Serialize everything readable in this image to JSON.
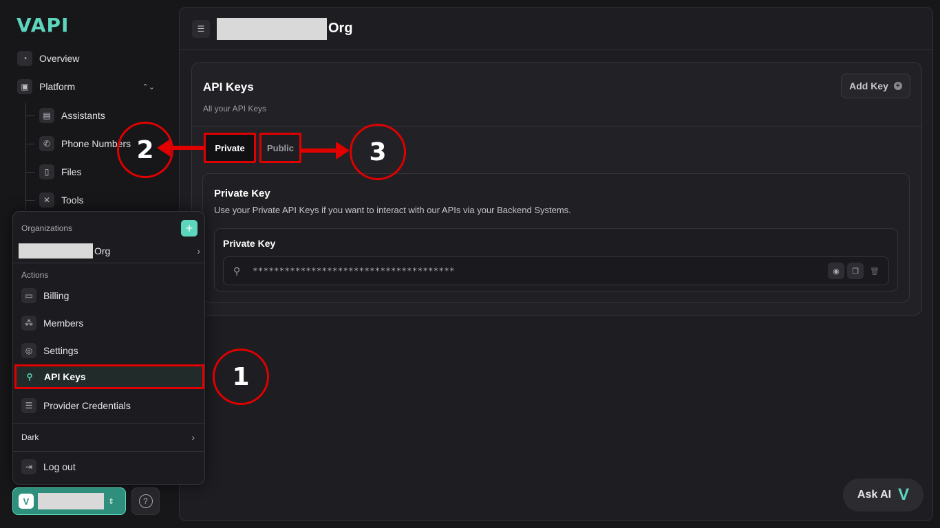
{
  "app": {
    "logo": "VAPI"
  },
  "sidebar": {
    "items": [
      {
        "label": "Overview",
        "icon": "chart-icon"
      },
      {
        "label": "Platform",
        "icon": "chip-icon"
      },
      {
        "label": "Assistants",
        "icon": "user-card-icon"
      },
      {
        "label": "Phone Numbers",
        "icon": "phone-icon"
      },
      {
        "label": "Files",
        "icon": "file-icon"
      },
      {
        "label": "Tools",
        "icon": "tools-icon"
      }
    ]
  },
  "header": {
    "org_suffix": "Org"
  },
  "api_keys": {
    "title": "API Keys",
    "subtitle": "All your API Keys",
    "add_key_label": "Add Key",
    "tabs": [
      "Private",
      "Public"
    ],
    "private_title": "Private Key",
    "private_desc": "Use your Private API Keys if you want to interact with our APIs via your Backend Systems.",
    "key_box_title": "Private Key",
    "masked_key": "**************************************"
  },
  "menu": {
    "organizations_label": "Organizations",
    "org_suffix": "Org",
    "actions_label": "Actions",
    "items": [
      "Billing",
      "Members",
      "Settings",
      "API Keys",
      "Provider Credentials"
    ],
    "theme_label": "Dark",
    "logout_label": "Log out"
  },
  "annotations": {
    "one": "1",
    "two": "2",
    "three": "3"
  },
  "footer": {
    "ask_ai": "Ask AI",
    "help": "?"
  },
  "colors": {
    "accent": "#5dd6be",
    "annotation": "#e00000"
  }
}
